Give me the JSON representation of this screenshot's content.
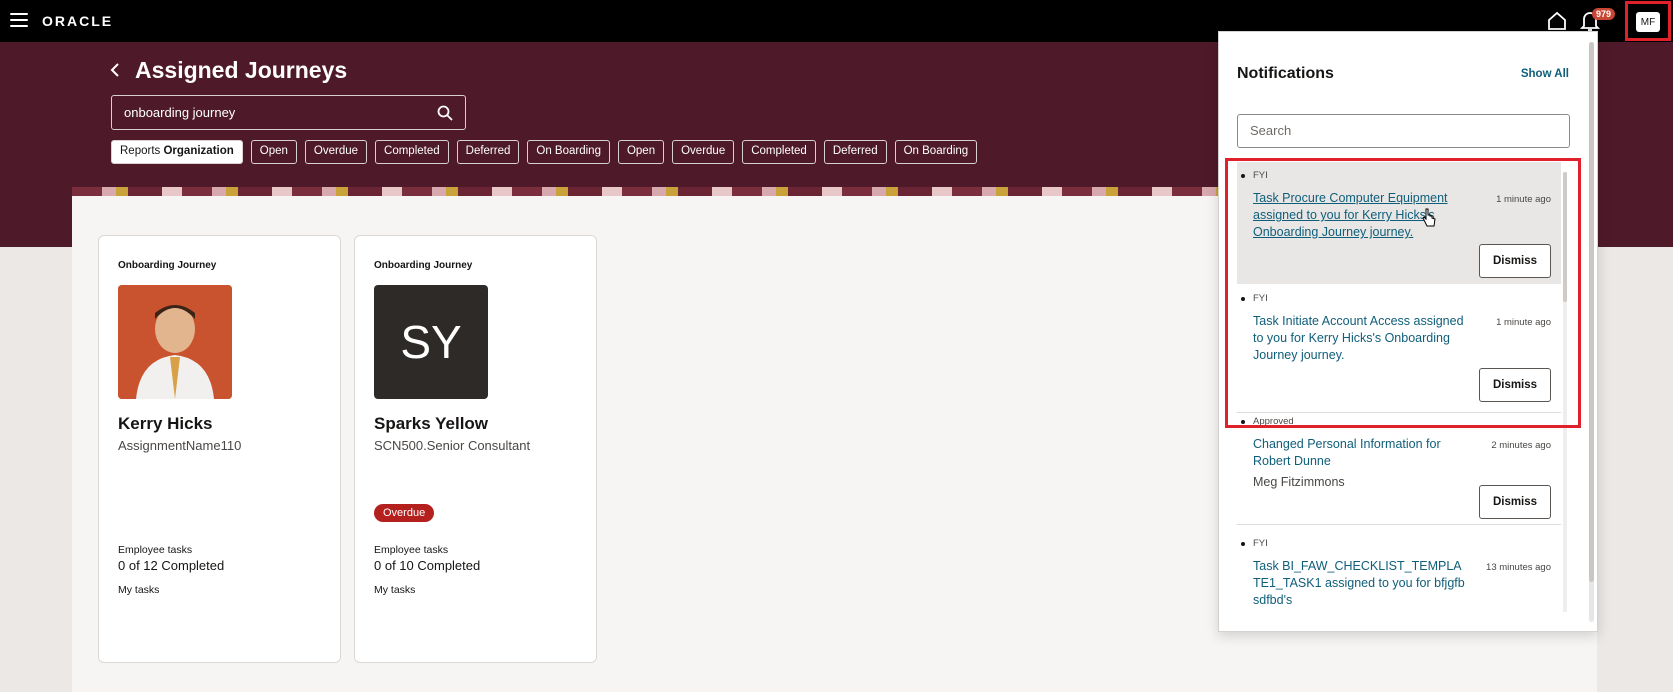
{
  "topbar": {
    "logo": "ORACLE",
    "notification_count": "979",
    "user_initials": "MF"
  },
  "header": {
    "title": "Assigned Journeys",
    "search_value": "onboarding journey"
  },
  "chips": {
    "first_prefix": "Reports",
    "first_bold": "Organization",
    "items": [
      "Open",
      "Overdue",
      "Completed",
      "Deferred",
      "On Boarding",
      "Open",
      "Overdue",
      "Completed",
      "Deferred",
      "On Boarding"
    ]
  },
  "cards": [
    {
      "type": "Onboarding Journey",
      "name": "Kerry Hicks",
      "assignment": "AssignmentName110",
      "tasks_label": "Employee tasks",
      "tasks_count": "0 of 12 Completed",
      "my_tasks": "My tasks"
    },
    {
      "type": "Onboarding Journey",
      "initials": "SY",
      "name": "Sparks Yellow",
      "assignment": "SCN500.Senior Consultant",
      "badge": "Overdue",
      "tasks_label": "Employee tasks",
      "tasks_count": "0 of 10 Completed",
      "my_tasks": "My tasks"
    }
  ],
  "notifications": {
    "title": "Notifications",
    "show_all": "Show All",
    "search_placeholder": "Search",
    "items": [
      {
        "kind": "FYI",
        "message": "Task Procure Computer Equipment assigned to you for Kerry Hicks's Onboarding Journey journey.",
        "time": "1 minute ago",
        "dismiss": "Dismiss"
      },
      {
        "kind": "FYI",
        "message": "Task Initiate Account Access assigned to you for Kerry Hicks's Onboarding Journey journey.",
        "time": "1 minute ago",
        "dismiss": "Dismiss"
      },
      {
        "kind": "Approved",
        "message": "Changed Personal Information for Robert Dunne",
        "sender": "Meg Fitzimmons",
        "time": "2 minutes ago",
        "dismiss": "Dismiss"
      },
      {
        "kind": "FYI",
        "message": "Task BI_FAW_CHECKLIST_TEMPLATE1_TASK1 assigned to you for bfjgfbsdfbd's",
        "time": "13 minutes ago"
      }
    ]
  },
  "colors": {
    "brand_band": "#4e1a2a",
    "accent_link": "#0f5e7a",
    "highlight": "#e0202b",
    "overdue": "#b3201e"
  }
}
